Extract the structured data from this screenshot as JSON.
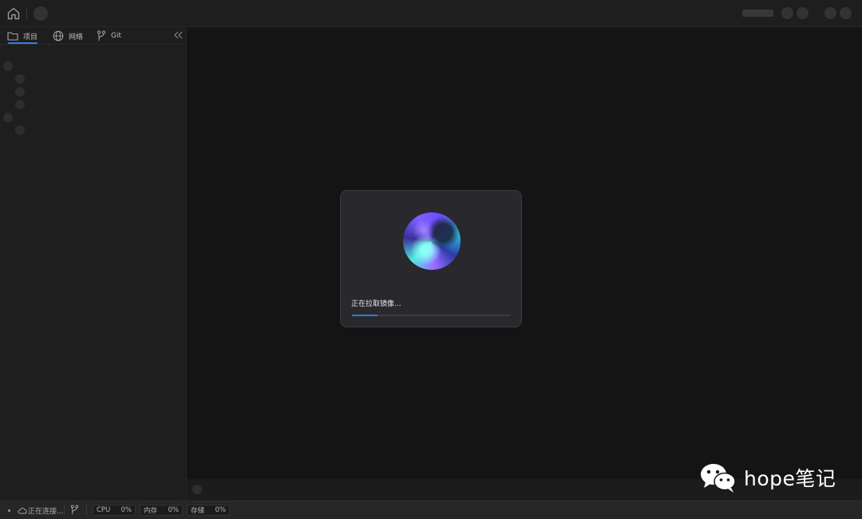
{
  "sidebar": {
    "tabs": [
      {
        "label": "项目",
        "icon": "folder-icon",
        "active": true
      },
      {
        "label": "网络",
        "icon": "globe-icon",
        "active": false
      },
      {
        "label": "Git",
        "icon": "git-branch-icon",
        "active": false
      }
    ]
  },
  "dialog": {
    "status": "正在拉取镜像...",
    "progress": 0.16
  },
  "statusbar": {
    "connection": "正在连接...",
    "cpu": {
      "label": "CPU",
      "value": "0%"
    },
    "memory": {
      "label": "内存",
      "value": "0%"
    },
    "storage": {
      "label": "存储",
      "value": "0%"
    }
  },
  "watermark": {
    "text": "hope笔记"
  },
  "colors": {
    "accent": "#2f7fe6",
    "background": "#141414",
    "panel": "#1e1e1e"
  }
}
